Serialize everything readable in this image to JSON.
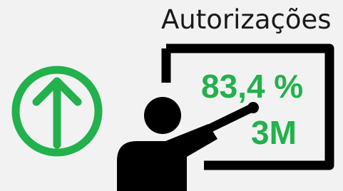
{
  "title": "Autorizações",
  "kpi": {
    "percent": "83,4 %",
    "amount": "3M",
    "trend": "up-arrow-icon"
  },
  "colors": {
    "accent": "#22b14c",
    "icon": "#000000",
    "background": "#f2f2f2"
  }
}
